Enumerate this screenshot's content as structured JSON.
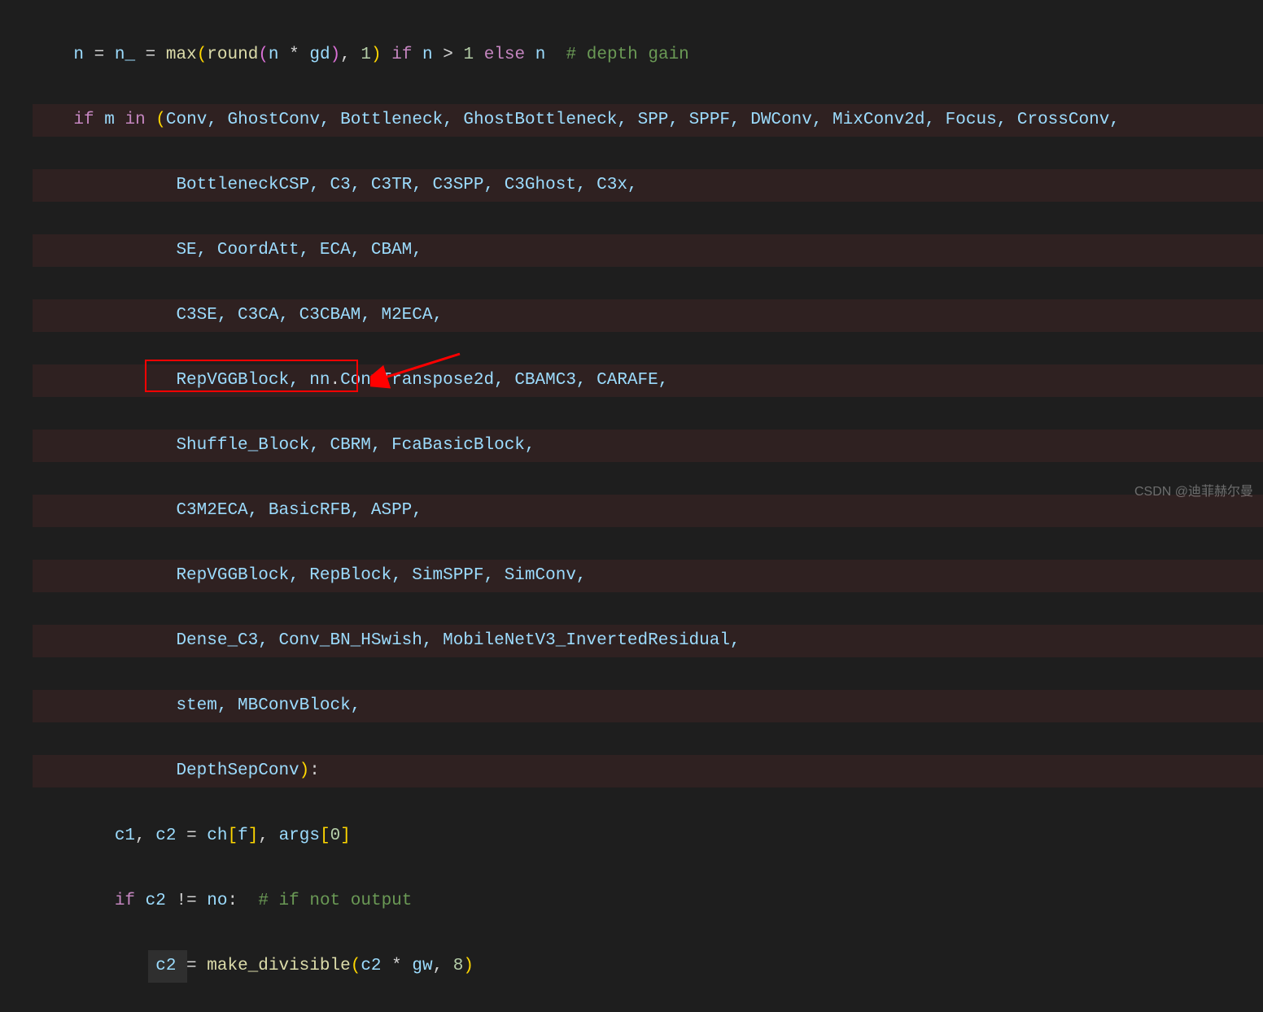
{
  "code": {
    "line1": {
      "var_n": "n",
      "eq": " = ",
      "var_n_": "n_",
      "fn_max": "max",
      "fn_round": "round",
      "var_n2": "n",
      "op_mul": " * ",
      "var_gd": "gd",
      "num_1": "1",
      "kw_if": "if",
      "var_n3": "n",
      "op_gt": " > ",
      "num_1b": "1",
      "kw_else": "else",
      "var_n4": "n",
      "comment": "# depth gain"
    },
    "line2": {
      "kw_if": "if",
      "var_m": "m",
      "kw_in": "in",
      "items": "Conv, GhostConv, Bottleneck, GhostBottleneck, SPP, SPPF, DWConv, MixConv2d, Focus, CrossConv,"
    },
    "line3": "BottleneckCSP, C3, C3TR, C3SPP, C3Ghost, C3x,",
    "line4": "SE, CoordAtt, ECA, CBAM,",
    "line5": "C3SE, C3CA, C3CBAM, M2ECA,",
    "line6_pre": "RepVGGBlock, nn",
    "line6_attr": "ConvTranspose2d",
    "line6_post": ", CBAMC3, CARAFE,",
    "line7": "Shuffle_Block, CBRM, FcaBasicBlock,",
    "line8": "C3M2ECA, BasicRFB, ASPP,",
    "line9": "RepVGGBlock, RepBlock, SimSPPF, SimConv,",
    "line10": "Dense_C3, Conv_BN_HSwish, MobileNetV3_InvertedResidual,",
    "line11": "stem, MBConvBlock,",
    "line12": "DepthSepConv",
    "line13": {
      "var_c1": "c1",
      "var_c2": "c2",
      "var_ch": "ch",
      "var_f": "f",
      "var_args": "args",
      "num_0": "0"
    },
    "line14": {
      "kw_if": "if",
      "var_c2": "c2",
      "op_ne": " != ",
      "var_no": "no",
      "comment": "# if not output"
    },
    "line15": {
      "var_c2": "c2",
      "fn": "make_divisible",
      "var_c2b": "c2",
      "op_mul": " * ",
      "var_gw": "gw",
      "num_8": "8"
    }
  },
  "watermark": "CSDN @迪菲赫尔曼"
}
